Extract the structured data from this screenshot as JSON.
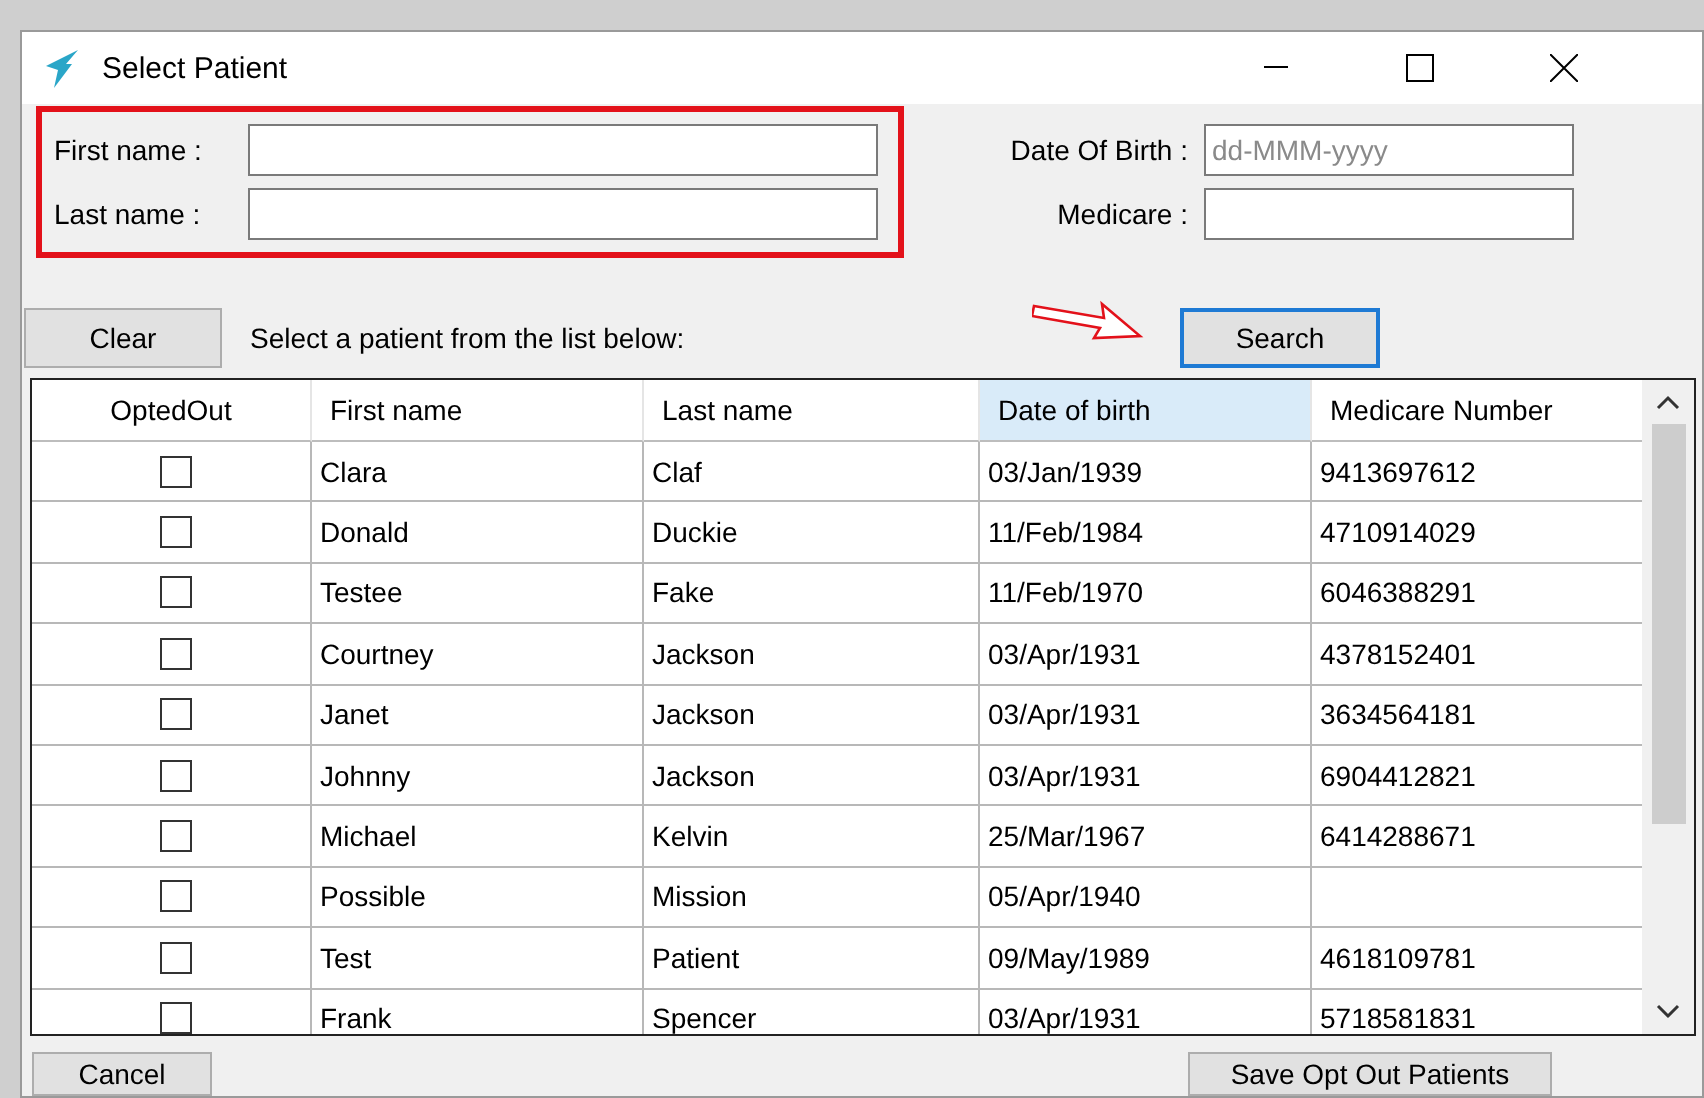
{
  "window": {
    "title": "Select Patient"
  },
  "search_form": {
    "fields": [
      {
        "label": "First name :"
      },
      {
        "label": "Last name :"
      }
    ],
    "side_fields": [
      {
        "label": "Date Of Birth :",
        "placeholder": "dd-MMM-yyyy"
      },
      {
        "label": "Medicare :"
      }
    ]
  },
  "toolbar": {
    "clear": "Clear",
    "hint": "Select a patient from the list below:",
    "search": "Search"
  },
  "table": {
    "columns": [
      {
        "label": "OptedOut",
        "selected": false
      },
      {
        "label": "First name",
        "selected": false
      },
      {
        "label": "Last name",
        "selected": false
      },
      {
        "label": "Date of birth",
        "selected": true
      },
      {
        "label": "Medicare Number",
        "selected": false
      }
    ],
    "rows": [
      {
        "opted_out": false,
        "first": "Clara",
        "last": "Claf",
        "dob": "03/Jan/1939",
        "medicare": "9413697612"
      },
      {
        "opted_out": false,
        "first": "Donald",
        "last": "Duckie",
        "dob": "11/Feb/1984",
        "medicare": "4710914029"
      },
      {
        "opted_out": false,
        "first": "Testee",
        "last": "Fake",
        "dob": "11/Feb/1970",
        "medicare": "6046388291"
      },
      {
        "opted_out": false,
        "first": "Courtney",
        "last": "Jackson",
        "dob": "03/Apr/1931",
        "medicare": "4378152401"
      },
      {
        "opted_out": false,
        "first": "Janet",
        "last": "Jackson",
        "dob": "03/Apr/1931",
        "medicare": "3634564181"
      },
      {
        "opted_out": false,
        "first": "Johnny",
        "last": "Jackson",
        "dob": "03/Apr/1931",
        "medicare": "6904412821"
      },
      {
        "opted_out": false,
        "first": "Michael",
        "last": "Kelvin",
        "dob": "25/Mar/1967",
        "medicare": "6414288671"
      },
      {
        "opted_out": false,
        "first": "Possible",
        "last": "Mission",
        "dob": "05/Apr/1940"
      },
      {
        "opted_out": false,
        "first": "Test",
        "last": "Patient",
        "dob": "09/May/1989",
        "medicare": "4618109781"
      },
      {
        "opted_out": false,
        "first": "Frank",
        "last": "Spencer",
        "dob": "03/Apr/1931",
        "medicare": "5718581831"
      }
    ]
  },
  "buttons": {
    "cancel": "Cancel",
    "save": "Save Opt Out Patients"
  }
}
